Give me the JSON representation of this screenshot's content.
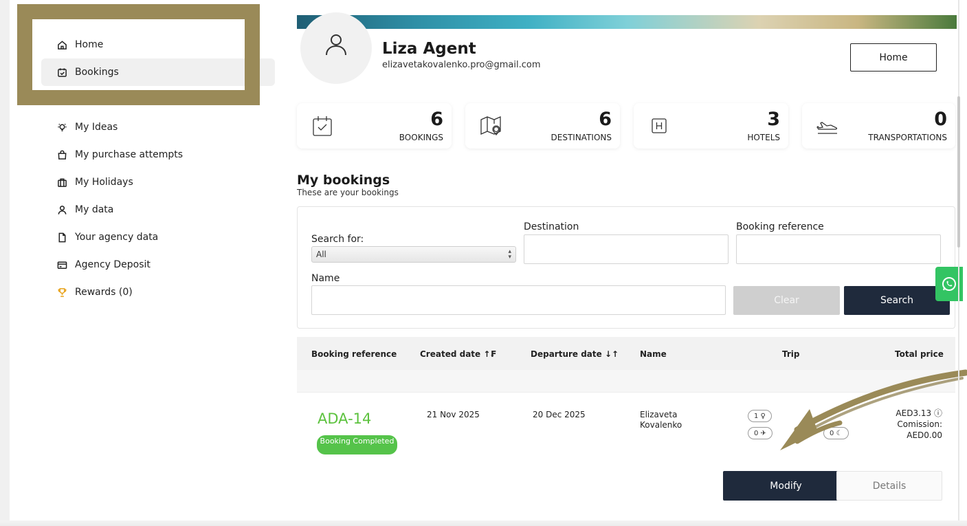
{
  "sidebar": {
    "items": [
      {
        "label": "Home",
        "icon": "home-icon"
      },
      {
        "label": "Bookings",
        "icon": "calendar-check-icon"
      },
      {
        "label": "",
        "icon": "hidden-icon"
      },
      {
        "label": "My Ideas",
        "icon": "lightbulb-icon"
      },
      {
        "label": "My purchase attempts",
        "icon": "shopping-bag-icon"
      },
      {
        "label": "My Holidays",
        "icon": "suitcase-icon"
      },
      {
        "label": "My data",
        "icon": "user-icon"
      },
      {
        "label": "Your agency data",
        "icon": "document-icon"
      },
      {
        "label": "Agency Deposit",
        "icon": "card-icon"
      },
      {
        "label": "Rewards (0)",
        "icon": "trophy-icon"
      }
    ]
  },
  "profile": {
    "name": "Liza Agent",
    "email": "elizavetakovalenko.pro@gmail.com",
    "home_button": "Home"
  },
  "stats": [
    {
      "value": "6",
      "label": "BOOKINGS",
      "icon": "calendar-check-icon"
    },
    {
      "value": "6",
      "label": "DESTINATIONS",
      "icon": "map-pin-icon"
    },
    {
      "value": "3",
      "label": "HOTELS",
      "icon": "hotel-icon"
    },
    {
      "value": "0",
      "label": "TRANSPORTATIONS",
      "icon": "plane-icon"
    }
  ],
  "bookings": {
    "title": "My bookings",
    "subtitle": "These are your bookings",
    "search": {
      "search_for_label": "Search for:",
      "search_for_value": "All",
      "destination_label": "Destination",
      "destination_value": "",
      "reference_label": "Booking reference",
      "reference_value": "",
      "name_label": "Name",
      "name_value": "",
      "clear_button": "Clear",
      "search_button": "Search"
    },
    "columns": [
      "Booking reference",
      "Created date ↑₣",
      "Departure date ↓↑",
      "Name",
      "Trip",
      "Total price"
    ],
    "rows": [
      {
        "reference": "ADA-14",
        "status": "Booking Completed",
        "created": "21 Nov 2025",
        "departure": "20 Dec 2025",
        "name_first": "Elizaveta",
        "name_last": "Kovalenko",
        "trip_pills": [
          "1 ♀",
          "0 ✈",
          "0 ☾"
        ],
        "price": "AED3.13 ⓘ",
        "commission_label": "Comission:",
        "commission_value": "AED0.00",
        "modify_button": "Modify",
        "details_button": "Details"
      }
    ]
  },
  "colors": {
    "accent_dark": "#1f2a3c",
    "success_green": "#5cc23e",
    "highlight_border": "#9a8a58",
    "whatsapp_green": "#33c463"
  }
}
